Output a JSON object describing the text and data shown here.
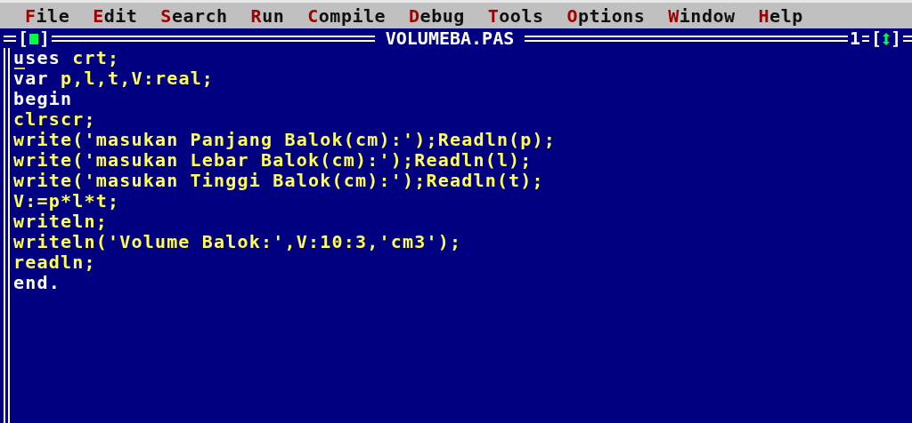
{
  "menu": [
    {
      "key": "F",
      "rest": "ile"
    },
    {
      "key": "E",
      "rest": "dit"
    },
    {
      "key": "S",
      "rest": "earch"
    },
    {
      "key": "R",
      "rest": "un"
    },
    {
      "key": "C",
      "rest": "ompile"
    },
    {
      "key": "D",
      "rest": "ebug"
    },
    {
      "key": "T",
      "rest": "ools"
    },
    {
      "key": "O",
      "rest": "ptions"
    },
    {
      "key": "W",
      "rest": "indow"
    },
    {
      "key": "H",
      "rest": "elp"
    }
  ],
  "window": {
    "title": "VOLUMEBA.PAS",
    "number": "1",
    "close_open": "[",
    "close_end": "]",
    "zoom_open": "[",
    "zoom_end": "]"
  },
  "code": [
    [
      {
        "kind": "keyword",
        "text": "uses"
      },
      {
        "kind": "text",
        "text": " crt;"
      }
    ],
    [
      {
        "kind": "keyword",
        "text": "var"
      },
      {
        "kind": "text",
        "text": " p,l,t,V:real;"
      }
    ],
    [
      {
        "kind": "keyword",
        "text": "begin"
      }
    ],
    [
      {
        "kind": "text",
        "text": "clrscr;"
      }
    ],
    [
      {
        "kind": "text",
        "text": "write('masukan Panjang Balok(cm):');Readln(p);"
      }
    ],
    [
      {
        "kind": "text",
        "text": "write('masukan Lebar Balok(cm):');Readln(l);"
      }
    ],
    [
      {
        "kind": "text",
        "text": "write('masukan Tinggi Balok(cm):');Readln(t);"
      }
    ],
    [
      {
        "kind": "text",
        "text": "V:=p*l*t;"
      }
    ],
    [
      {
        "kind": "text",
        "text": "writeln;"
      }
    ],
    [
      {
        "kind": "text",
        "text": "writeln('Volume Balok:',V:10:3,'cm3');"
      }
    ],
    [
      {
        "kind": "text",
        "text": "readln;"
      }
    ],
    [
      {
        "kind": "keyword",
        "text": "end."
      }
    ]
  ]
}
